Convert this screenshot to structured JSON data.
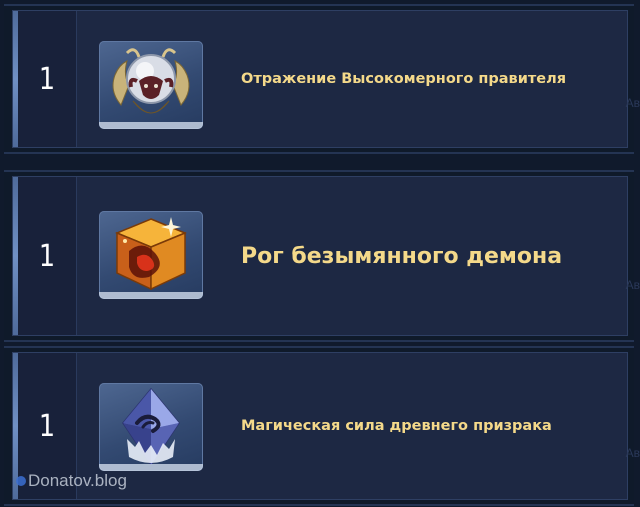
{
  "items": [
    {
      "count": "1",
      "name": "Отражение Высокомерного правителя",
      "icon": "ram-skull-crest-icon"
    },
    {
      "count": "1",
      "name": "Рог безымянного демона",
      "icon": "fiery-cube-icon"
    },
    {
      "count": "1",
      "name": "Магическая сила древнего призрака",
      "icon": "blue-crystal-icon"
    }
  ],
  "watermark": "Donatov.blog",
  "ghost_text": "Ав",
  "colors": {
    "background": "#101a2c",
    "row_fill": "#1d2843",
    "item_name": "#f4d98a",
    "count": "#ffffff"
  }
}
